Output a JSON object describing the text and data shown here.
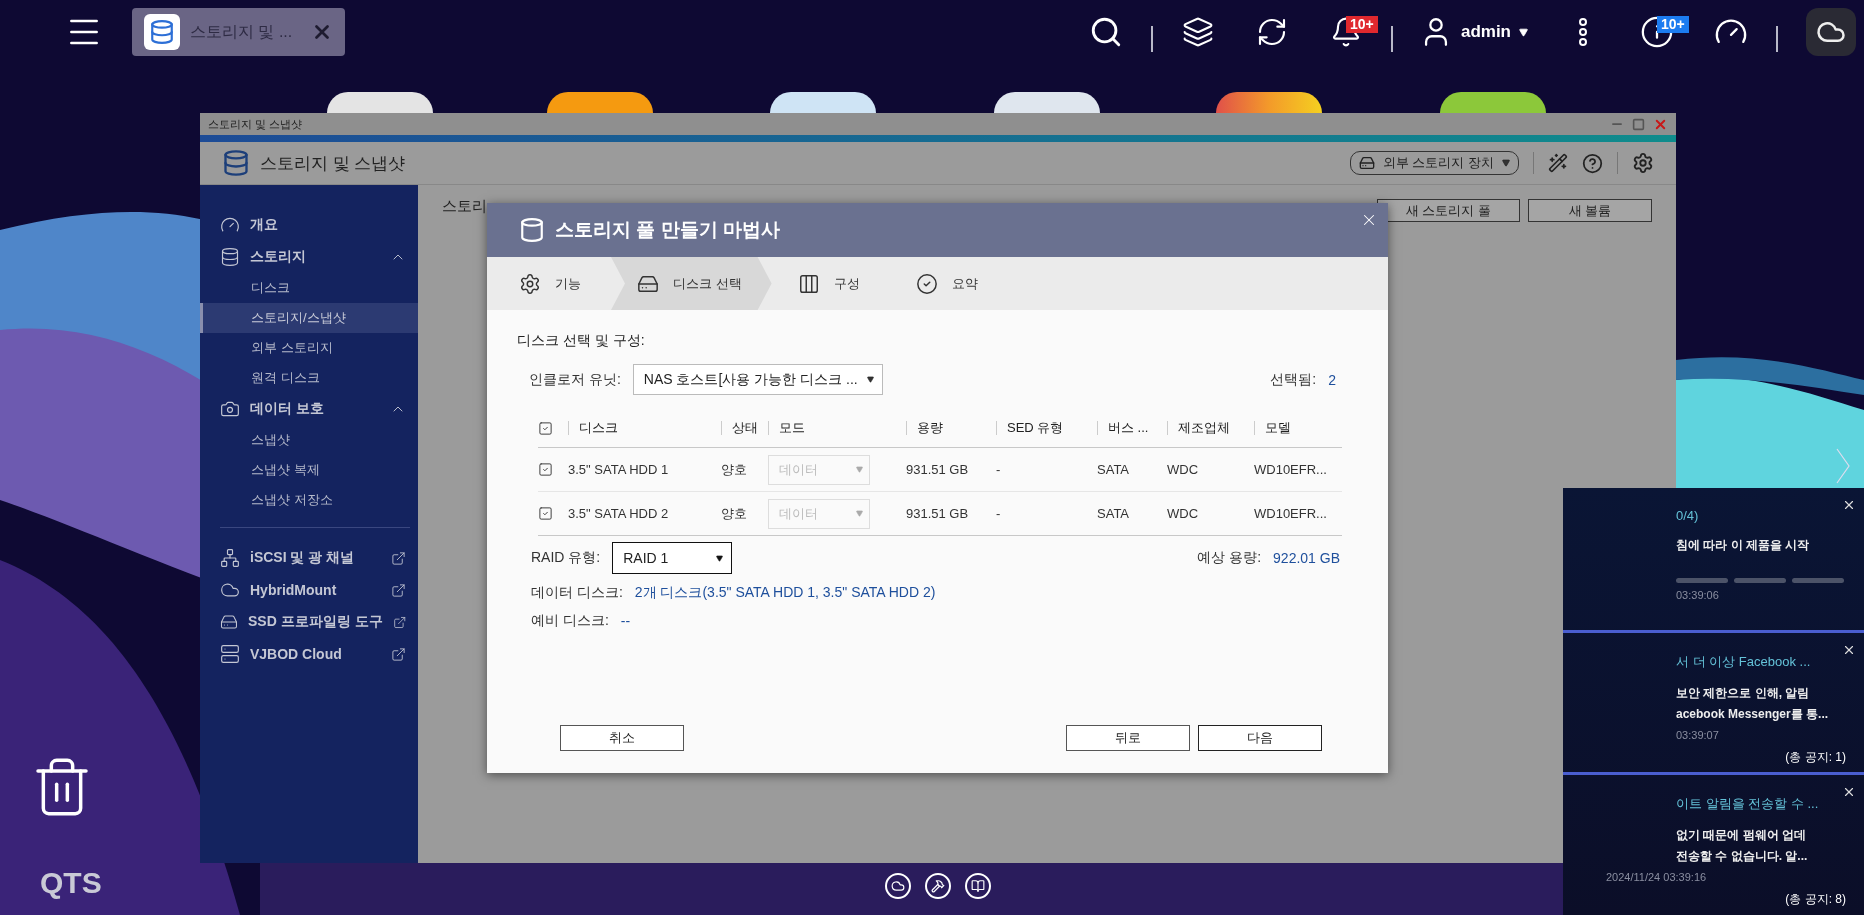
{
  "top_bar": {
    "tab": {
      "title": "스토리지 및 ..."
    },
    "user": "admin",
    "notification_badge": "10+",
    "info_badge": "10+"
  },
  "window": {
    "title": "스토리지 및 스냅샷",
    "app_title": "스토리지 및 스냅샷",
    "external_device": "외부 스토리지 장치",
    "page_title": "스토리",
    "buttons": [
      "새 스토리지 풀",
      "새 볼륨"
    ]
  },
  "sidebar": {
    "items": [
      {
        "label": "개요",
        "kind": "section"
      },
      {
        "label": "스토리지",
        "kind": "section",
        "expanded": true,
        "children": [
          {
            "label": "디스크",
            "selected": false
          },
          {
            "label": "스토리지/스냅샷",
            "selected": true
          },
          {
            "label": "외부 스토리지",
            "selected": false
          },
          {
            "label": "원격 디스크",
            "selected": false
          }
        ]
      },
      {
        "label": "데이터 보호",
        "kind": "section",
        "expanded": true,
        "children": [
          {
            "label": "스냅샷",
            "selected": false
          },
          {
            "label": "스냅샷 복제",
            "selected": false
          },
          {
            "label": "스냅샷 저장소",
            "selected": false
          }
        ]
      },
      {
        "label": "iSCSI 및 광 채널",
        "kind": "external"
      },
      {
        "label": "HybridMount",
        "kind": "external"
      },
      {
        "label": "SSD 프로파일링 도구",
        "kind": "external"
      },
      {
        "label": "VJBOD Cloud",
        "kind": "external"
      }
    ]
  },
  "dialog": {
    "title": "스토리지 풀 만들기 마법사",
    "steps": [
      {
        "label": "기능",
        "selected": false
      },
      {
        "label": "디스크 선택",
        "selected": true
      },
      {
        "label": "구성",
        "selected": false
      },
      {
        "label": "요약",
        "selected": false
      }
    ],
    "section_title": "디스크 선택 및 구성:",
    "enclosure": {
      "label": "인클로저 유닛:",
      "value": "NAS 호스트[사용 가능한 디스크 ..."
    },
    "selected": {
      "label": "선택됨:",
      "value": "2"
    },
    "table": {
      "all_checked": true,
      "columns": [
        "디스크",
        "상태",
        "모드",
        "용량",
        "SED 유형",
        "버스 ...",
        "제조업체",
        "모델"
      ],
      "rows": [
        {
          "checked": true,
          "cells": [
            "3.5\" SATA HDD 1",
            "양호",
            "데이터",
            "931.51 GB",
            "-",
            "SATA",
            "WDC",
            "WD10EFR..."
          ]
        },
        {
          "checked": true,
          "cells": [
            "3.5\" SATA HDD 2",
            "양호",
            "데이터",
            "931.51 GB",
            "-",
            "SATA",
            "WDC",
            "WD10EFR..."
          ]
        }
      ]
    },
    "raid": {
      "label": "RAID 유형:",
      "value": "RAID 1"
    },
    "estimate": {
      "label": "예상 용량:",
      "value": "922.01 GB"
    },
    "data_disks": {
      "label": "데이터 디스크:",
      "value": "2개 디스크(3.5\" SATA HDD 1, 3.5\" SATA HDD 2)"
    },
    "spare_disks": {
      "label": "예비 디스크:",
      "value": "--"
    },
    "buttons": [
      {
        "label": "취소",
        "kind": "cancel"
      },
      {
        "label": "뒤로",
        "kind": "back"
      },
      {
        "label": "다음",
        "kind": "next"
      }
    ]
  },
  "notifications": [
    {
      "title": "0/4)",
      "body": [
        "침에 따라 이 제품을 시작"
      ],
      "pager": true,
      "time": "03:39:06"
    },
    {
      "title": "서 더 이상 Facebook ...",
      "body": [
        "보안 제한으로 인해, 알림",
        "acebook Messenger를 통..."
      ],
      "time": "03:39:07",
      "count": "(총 공지: 1)"
    },
    {
      "title": "이트 알림을 전송할 수 ...",
      "body": [
        "없기 때문에 펌웨어 업데",
        "전송할 수 없습니다. 알..."
      ],
      "time": "2024/11/24 03:39:16",
      "count": "(총 공지: 8)"
    }
  ],
  "desktop": {
    "brand": "QTS"
  }
}
